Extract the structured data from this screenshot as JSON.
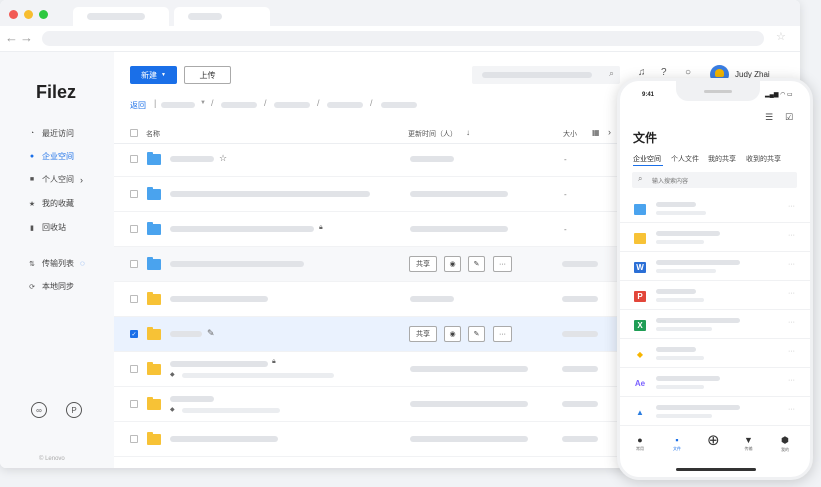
{
  "app": {
    "name": "Filez",
    "footer": "© Lenovo"
  },
  "sidebar": {
    "items": [
      {
        "label": "最近访问",
        "icon": "clock-icon"
      },
      {
        "label": "企业空间",
        "icon": "enterprise-icon",
        "active": true
      },
      {
        "label": "个人空间",
        "icon": "personal-icon",
        "expand": "›"
      },
      {
        "label": "我的收藏",
        "icon": "star-icon"
      },
      {
        "label": "回收站",
        "icon": "trash-icon"
      },
      {
        "label": "传输列表",
        "icon": "transfer-icon"
      },
      {
        "label": "本地同步",
        "icon": "sync-icon"
      }
    ]
  },
  "toolbar": {
    "new_label": "新建",
    "upload_label": "上传",
    "user_name": "Judy Zhai"
  },
  "breadcrumb": {
    "back_label": "返回"
  },
  "table": {
    "headers": {
      "name": "名称",
      "updated": "更新时间（人）",
      "size": "大小"
    },
    "rows": [
      {
        "icon": "folder-blue",
        "size": "-"
      },
      {
        "icon": "folder-blue",
        "size": "-"
      },
      {
        "icon": "folder-blue",
        "size": "-"
      },
      {
        "icon": "folder-blue",
        "size": ""
      },
      {
        "icon": "folder-yellow",
        "size": ""
      },
      {
        "icon": "folder-yellow",
        "size": ""
      },
      {
        "icon": "folder-yellow",
        "size": ""
      },
      {
        "icon": "folder-yellow",
        "size": ""
      },
      {
        "icon": "folder-yellow",
        "size": ""
      }
    ],
    "share_label": "共享"
  },
  "phone": {
    "time": "9:41",
    "title": "文件",
    "tabs": [
      "企业空间",
      "个人文件",
      "我的共享",
      "收到的共享"
    ],
    "search_placeholder": "输入搜索内容",
    "files": [
      {
        "icon": "folder-blue-icon",
        "glyph": "",
        "color": "#4aa3ee"
      },
      {
        "icon": "folder-yellow-icon",
        "glyph": "",
        "color": "#f7c236"
      },
      {
        "icon": "word-icon",
        "glyph": "W",
        "color": "#2b6fd6"
      },
      {
        "icon": "powerpoint-icon",
        "glyph": "P",
        "color": "#e2463a"
      },
      {
        "icon": "excel-icon",
        "glyph": "X",
        "color": "#1f9d55"
      },
      {
        "icon": "sketch-icon",
        "glyph": "◆",
        "color": "#f7b500"
      },
      {
        "icon": "aftereffects-icon",
        "glyph": "Ae",
        "color": "#7b61ff"
      },
      {
        "icon": "image-icon",
        "glyph": "▲",
        "color": "#2b7de0"
      }
    ],
    "nav": [
      {
        "label": "常用",
        "glyph": "●"
      },
      {
        "label": "文件",
        "glyph": "▪",
        "active": true
      },
      {
        "label": "",
        "glyph": "⊕"
      },
      {
        "label": "传输",
        "glyph": "▼"
      },
      {
        "label": "我的",
        "glyph": "⬢"
      }
    ]
  }
}
